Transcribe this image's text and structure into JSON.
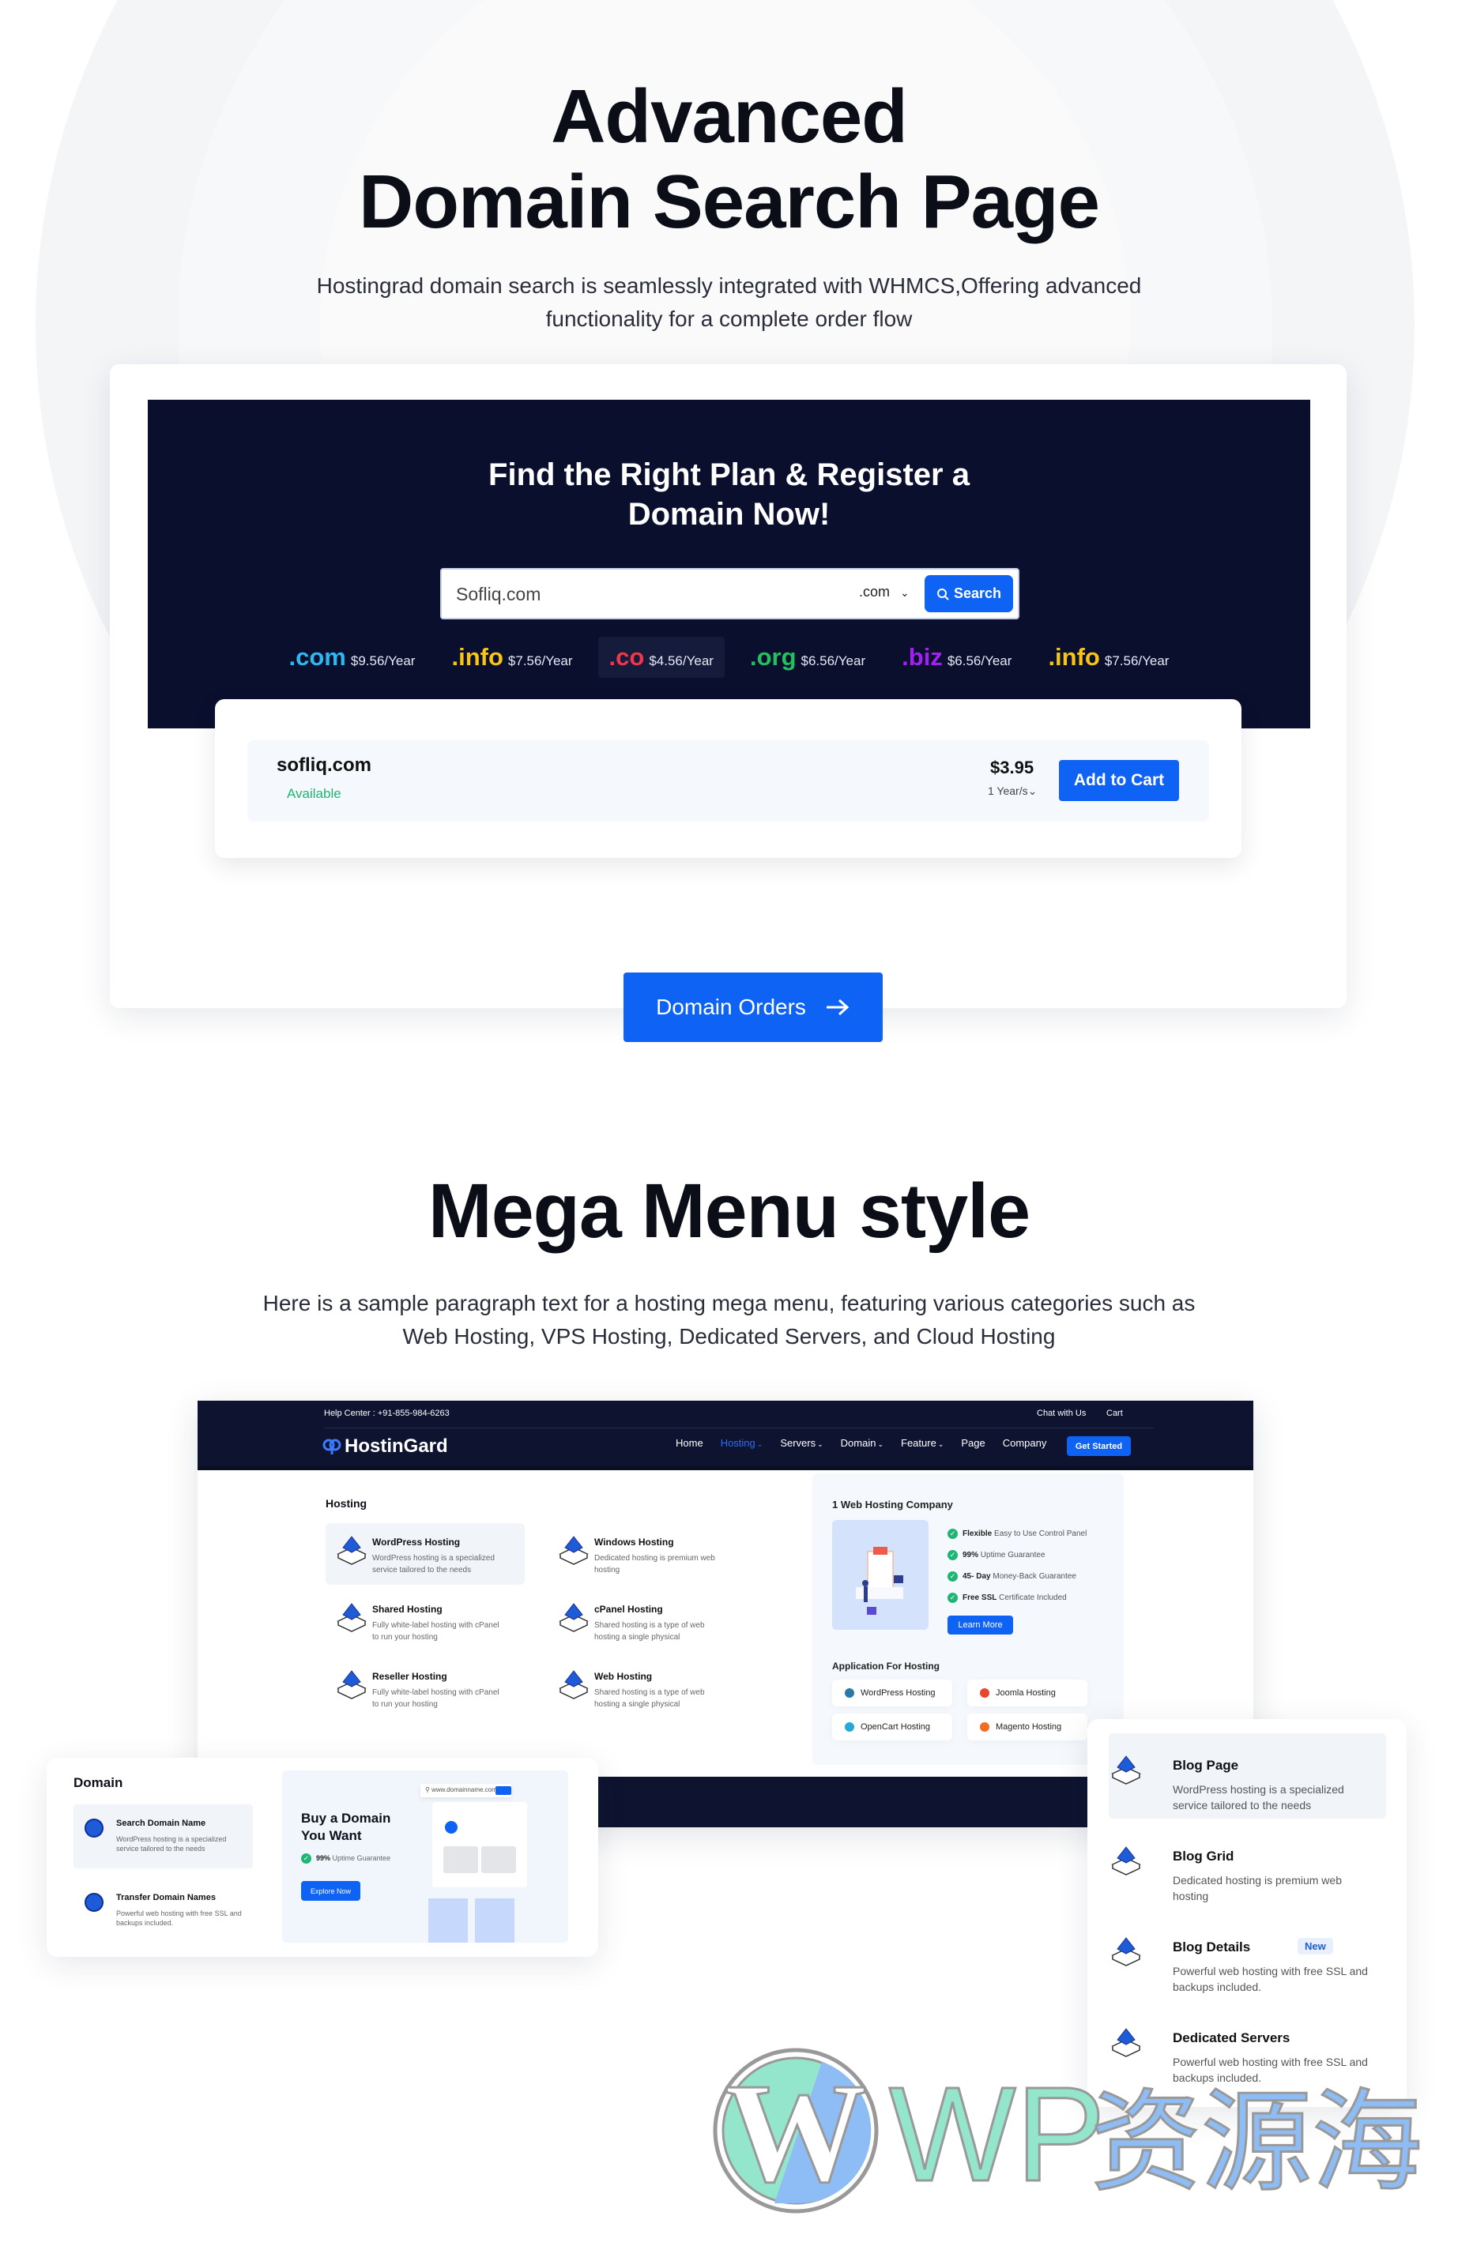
{
  "hero": {
    "title_line1": "Advanced",
    "title_line2": "Domain Search Page",
    "subtitle_line1": "Hostingrad domain search is seamlessly integrated with WHMCS,Offering advanced",
    "subtitle_line2": "functionality for a complete order flow"
  },
  "domain_search": {
    "heading_line1": "Find the Right Plan & Register a",
    "heading_line2": "Domain Now!",
    "input_value": "Sofliq.com",
    "tld_select": ".com",
    "search_label": "Search",
    "tlds": [
      {
        "ext": ".com",
        "price": "$9.56/Year",
        "color": "#2fb7f0"
      },
      {
        "ext": ".info",
        "price": "$7.56/Year",
        "color": "#f6c515"
      },
      {
        "ext": ".co",
        "price": "$4.56/Year",
        "color": "#f0364b"
      },
      {
        "ext": ".org",
        "price": "$6.56/Year",
        "color": "#23c15e"
      },
      {
        "ext": ".biz",
        "price": "$6.56/Year",
        "color": "#a122f0"
      },
      {
        "ext": ".info",
        "price": "$7.56/Year",
        "color": "#f6c515"
      }
    ],
    "result": {
      "domain": "sofliq.com",
      "status": "Available",
      "price": "$3.95",
      "period": "1 Year/s",
      "add_label": "Add to Cart"
    }
  },
  "domain_orders_label": "Domain Orders",
  "mega_section": {
    "title": "Mega Menu style",
    "paragraph_line1": "Here is a sample paragraph text for a hosting mega menu, featuring various categories such as",
    "paragraph_line2": "Web Hosting, VPS Hosting, Dedicated Servers, and Cloud Hosting"
  },
  "mega_menu": {
    "help": "Help Center : +91-855-984-6263",
    "chat": "Chat with Us",
    "cart": "Cart",
    "logo": "HostinGard",
    "nav": [
      "Home",
      "Hosting",
      "Servers",
      "Domain",
      "Feature",
      "Page",
      "Company"
    ],
    "get_started": "Get Started",
    "hosting_title": "Hosting",
    "hosting_items": [
      {
        "title": "WordPress Hosting",
        "desc": "WordPress hosting is a specialized service tailored to the needs"
      },
      {
        "title": "Windows Hosting",
        "desc": "Dedicated hosting is premium web hosting"
      },
      {
        "title": "Shared Hosting",
        "desc": "Fully  white-label hosting with cPanel to run your hosting"
      },
      {
        "title": "cPanel Hosting",
        "desc": "Shared hosting is a type of web hosting a single physical"
      },
      {
        "title": "Reseller Hosting",
        "desc": "Fully  white-label hosting with cPanel to run your hosting"
      },
      {
        "title": "Web Hosting",
        "desc": "Shared hosting is a type of web hosting a single physical"
      }
    ],
    "company_title": "1 Web Hosting Company",
    "features": [
      {
        "bold": "Flexible",
        "text": "Easy to Use Control Panel"
      },
      {
        "bold": "99%",
        "text": "Uptime Guarantee"
      },
      {
        "bold": "45- Day",
        "text": "Money-Back Guarantee"
      },
      {
        "bold": "Free SSL",
        "text": "Certificate Included"
      }
    ],
    "learn_more": "Learn More",
    "apps_title": "Application For Hosting",
    "apps": [
      "WordPress Hosting",
      "Joomla Hosting",
      "OpenCart Hosting",
      "Magento Hosting"
    ]
  },
  "domain_menu": {
    "title": "Domain",
    "items": [
      {
        "title": "Search Domain Name",
        "desc": "WordPress hosting is a specialized service tailored to the needs"
      },
      {
        "title": "Transfer Domain Names",
        "desc": "Powerful web hosting with free SSL and backups included."
      }
    ],
    "promo_title_line1": "Buy a Domain",
    "promo_title_line2": "You Want",
    "promo_bold": "99%",
    "promo_text": "Uptime Guarantee",
    "explore": "Explore Now",
    "mock_url": "www.domainname.com"
  },
  "blog_menu": {
    "items": [
      {
        "title": "Blog Page",
        "desc": "WordPress hosting is a specialized service tailored to the needs"
      },
      {
        "title": "Blog Grid",
        "desc": "Dedicated hosting is premium web hosting"
      },
      {
        "title": "Blog Details",
        "desc": "Powerful web hosting with free SSL and backups included.",
        "badge": "New"
      },
      {
        "title": "Dedicated Servers",
        "desc": "Powerful web hosting with free SSL and backups included."
      }
    ]
  },
  "watermark": {
    "text": "WP资源海"
  },
  "colors": {
    "accent": "#0e63f4",
    "dark": "#0a0f2e",
    "success": "#1fb574"
  }
}
